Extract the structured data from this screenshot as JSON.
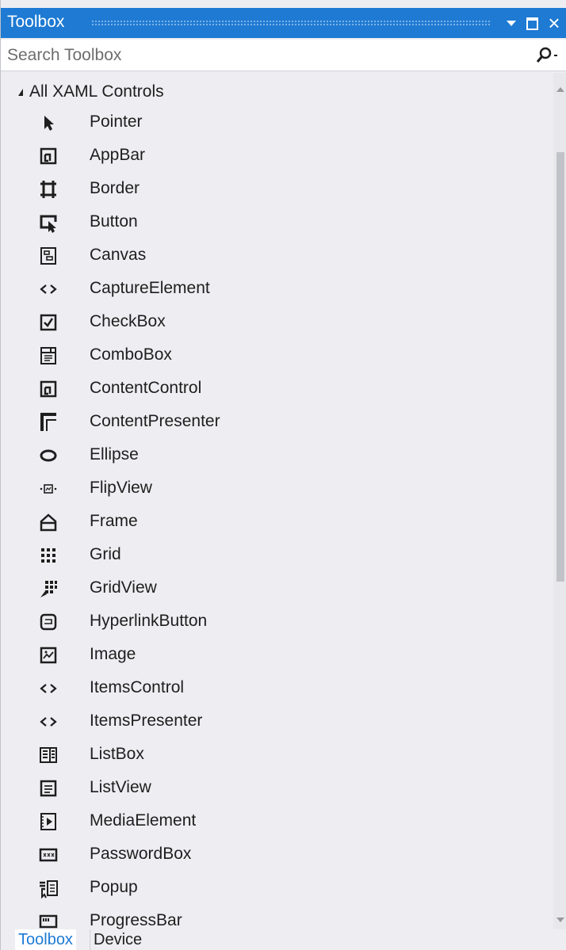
{
  "window": {
    "title": "Toolbox",
    "buttons": {
      "dropdown": "window-position-menu",
      "maximize": "maximize",
      "close": "×"
    }
  },
  "search": {
    "placeholder": "Search Toolbox"
  },
  "group": {
    "label": "All XAML Controls",
    "expanded": true
  },
  "items": [
    {
      "label": "Pointer",
      "icon": "pointer-icon"
    },
    {
      "label": "AppBar",
      "icon": "appbar-icon"
    },
    {
      "label": "Border",
      "icon": "border-icon"
    },
    {
      "label": "Button",
      "icon": "button-icon"
    },
    {
      "label": "Canvas",
      "icon": "canvas-icon"
    },
    {
      "label": "CaptureElement",
      "icon": "code-brackets-icon"
    },
    {
      "label": "CheckBox",
      "icon": "checkbox-icon"
    },
    {
      "label": "ComboBox",
      "icon": "combobox-icon"
    },
    {
      "label": "ContentControl",
      "icon": "contentcontrol-icon"
    },
    {
      "label": "ContentPresenter",
      "icon": "contentpresenter-icon"
    },
    {
      "label": "Ellipse",
      "icon": "ellipse-icon"
    },
    {
      "label": "FlipView",
      "icon": "flipview-icon"
    },
    {
      "label": "Frame",
      "icon": "frame-icon"
    },
    {
      "label": "Grid",
      "icon": "grid-icon"
    },
    {
      "label": "GridView",
      "icon": "gridview-icon"
    },
    {
      "label": "HyperlinkButton",
      "icon": "hyperlinkbutton-icon"
    },
    {
      "label": "Image",
      "icon": "image-icon"
    },
    {
      "label": "ItemsControl",
      "icon": "code-brackets-icon"
    },
    {
      "label": "ItemsPresenter",
      "icon": "code-brackets-icon"
    },
    {
      "label": "ListBox",
      "icon": "listbox-icon"
    },
    {
      "label": "ListView",
      "icon": "listview-icon"
    },
    {
      "label": "MediaElement",
      "icon": "mediaelement-icon"
    },
    {
      "label": "PasswordBox",
      "icon": "passwordbox-icon"
    },
    {
      "label": "Popup",
      "icon": "popup-icon"
    },
    {
      "label": "ProgressBar",
      "icon": "progressbar-icon"
    }
  ],
  "tabs": [
    {
      "label": "Toolbox",
      "active": true
    },
    {
      "label": "Device",
      "active": false
    }
  ],
  "colors": {
    "accent": "#1e7ad3",
    "panel": "#eeeef2",
    "text": "#1e1e1e"
  }
}
